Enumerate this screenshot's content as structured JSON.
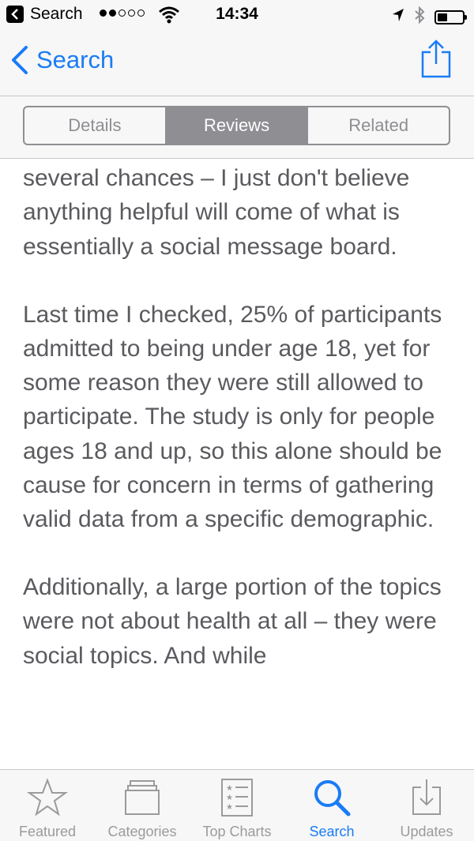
{
  "status_bar": {
    "back_app_label": "Search",
    "time": "14:34",
    "signal_bars_filled": 2,
    "signal_bars_total": 5,
    "battery_level": 0.4
  },
  "nav": {
    "back_label": "Search",
    "share_icon": "share-icon",
    "accent_color": "#1a7cf5"
  },
  "segments": {
    "items": [
      "Details",
      "Reviews",
      "Related"
    ],
    "selected": "Reviews"
  },
  "review": {
    "paragraphs": [
      "ended up deleting this app after giving it several chances – I just don't believe anything helpful will come of what is essentially a social message board.",
      "Last time I checked, 25% of participants admitted to being under age 18, yet for some reason they were still allowed to participate. The study is only for people ages 18 and up, so this alone should be cause for concern in terms of gathering valid data from a specific demographic.",
      "Additionally, a large portion of the topics were not about health at all – they were social topics. And while"
    ]
  },
  "tab_bar": {
    "items": [
      {
        "label": "Featured",
        "icon": "star-icon"
      },
      {
        "label": "Categories",
        "icon": "stack-icon"
      },
      {
        "label": "Top Charts",
        "icon": "list-icon"
      },
      {
        "label": "Search",
        "icon": "search-icon"
      },
      {
        "label": "Updates",
        "icon": "download-icon"
      }
    ],
    "selected": "Search"
  }
}
